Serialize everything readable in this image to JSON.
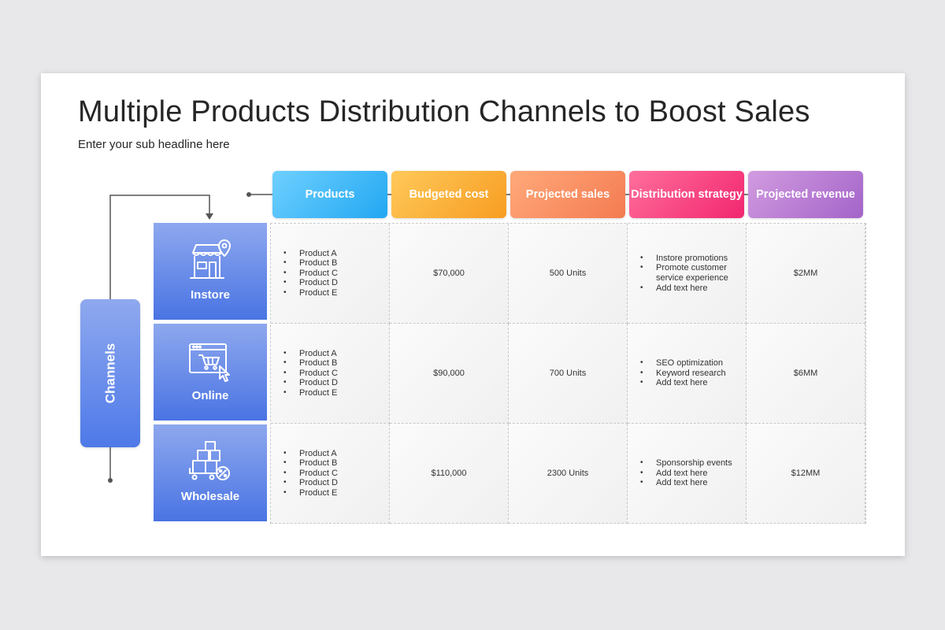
{
  "title": "Multiple Products Distribution Channels to Boost Sales",
  "subtitle": "Enter your sub headline here",
  "channels_label": "Channels",
  "headers": [
    {
      "label": "Products",
      "color_from": "#6fd0ff",
      "color_to": "#22a7f2"
    },
    {
      "label": "Budgeted cost",
      "color_from": "#ffc95a",
      "color_to": "#f79d22"
    },
    {
      "label": "Projected sales",
      "color_from": "#ffa97a",
      "color_to": "#f47b52"
    },
    {
      "label": "Distribution strategy",
      "color_from": "#ff6f9c",
      "color_to": "#f2266f"
    },
    {
      "label": "Projected revenue",
      "color_from": "#d29be0",
      "color_to": "#a364c9"
    }
  ],
  "rows": [
    {
      "channel": "Instore",
      "icon": "store-icon",
      "products": [
        "Product A",
        "Product B",
        "Product C",
        "Product D",
        "Product E"
      ],
      "budget": "$70,000",
      "sales": "500 Units",
      "strategy": [
        "Instore promotions",
        "Promote customer service experience",
        "Add text here"
      ],
      "revenue": "$2MM"
    },
    {
      "channel": "Online",
      "icon": "online-cart-icon",
      "products": [
        "Product A",
        "Product B",
        "Product C",
        "Product D",
        "Product E"
      ],
      "budget": "$90,000",
      "sales": "700 Units",
      "strategy": [
        "SEO optimization",
        "Keyword research",
        "Add text here"
      ],
      "revenue": "$6MM"
    },
    {
      "channel": "Wholesale",
      "icon": "wholesale-boxes-icon",
      "products": [
        "Product A",
        "Product B",
        "Product C",
        "Product D",
        "Product E"
      ],
      "budget": "$110,000",
      "sales": "2300 Units",
      "strategy": [
        "Sponsorship events",
        "Add text here",
        "Add text here"
      ],
      "revenue": "$12MM"
    }
  ]
}
